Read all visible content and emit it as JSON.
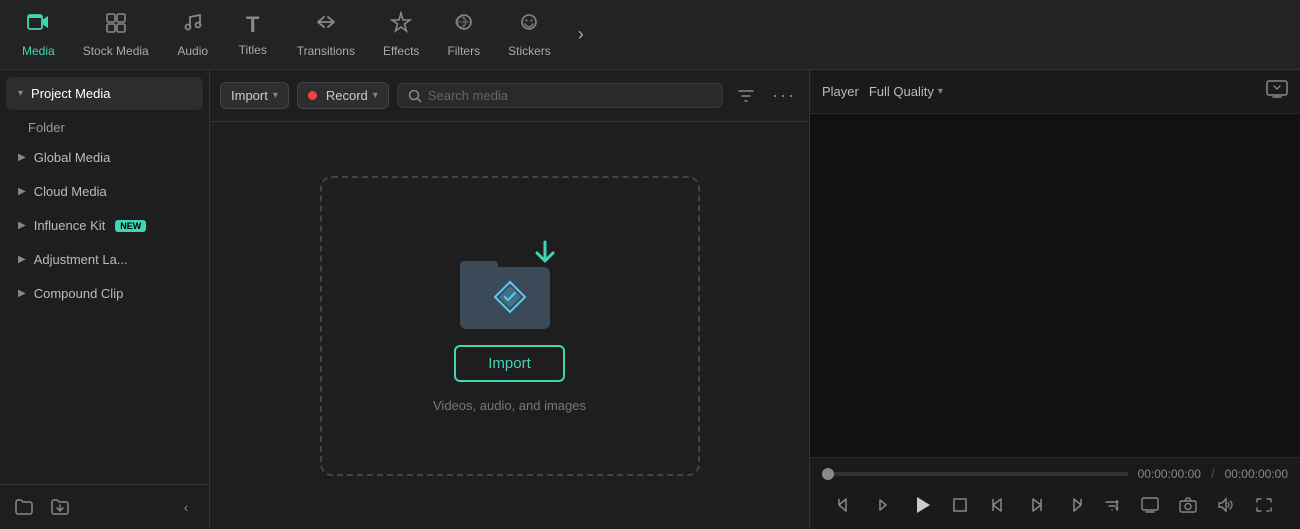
{
  "nav": {
    "items": [
      {
        "id": "media",
        "label": "Media",
        "icon": "🎬",
        "active": true
      },
      {
        "id": "stock-media",
        "label": "Stock Media",
        "icon": "📁"
      },
      {
        "id": "audio",
        "label": "Audio",
        "icon": "🎵"
      },
      {
        "id": "titles",
        "label": "Titles",
        "icon": "T"
      },
      {
        "id": "transitions",
        "label": "Transitions",
        "icon": "↔"
      },
      {
        "id": "effects",
        "label": "Effects",
        "icon": "✦"
      },
      {
        "id": "filters",
        "label": "Filters",
        "icon": "⊛"
      },
      {
        "id": "stickers",
        "label": "Stickers",
        "icon": "◕"
      }
    ],
    "more_icon": "›"
  },
  "sidebar": {
    "items": [
      {
        "id": "project-media",
        "label": "Project Media",
        "active": true,
        "chevron": "▾"
      },
      {
        "id": "folder",
        "label": "Folder",
        "indent": true
      },
      {
        "id": "global-media",
        "label": "Global Media",
        "chevron": "▶"
      },
      {
        "id": "cloud-media",
        "label": "Cloud Media",
        "chevron": "▶"
      },
      {
        "id": "influence-kit",
        "label": "Influence Kit",
        "chevron": "▶",
        "badge": "NEW"
      },
      {
        "id": "adjustment-layer",
        "label": "Adjustment La...",
        "chevron": "▶"
      },
      {
        "id": "compound-clip",
        "label": "Compound Clip",
        "chevron": "▶"
      }
    ],
    "bottom": {
      "new_folder_icon": "□+",
      "import_icon": "⊕",
      "collapse_icon": "‹"
    }
  },
  "toolbar": {
    "import_label": "Import",
    "import_arrow": "▾",
    "record_dot": true,
    "record_label": "Record",
    "record_arrow": "▾",
    "search_placeholder": "Search media",
    "filter_icon": "filter",
    "more_icon": "···"
  },
  "import_zone": {
    "button_label": "Import",
    "subtitle": "Videos, audio, and images"
  },
  "player": {
    "label": "Player",
    "quality": "Full Quality",
    "quality_arrow": "▾",
    "time_current": "00:00:00:00",
    "time_divider": "/",
    "time_total": "00:00:00:00",
    "controls": {
      "step_back": "⏮",
      "frame_back": "◁",
      "play": "▶",
      "stop": "◻",
      "mark_in": "{",
      "mark_out": "}",
      "forward": "⏭",
      "dropdown": "⌵",
      "screen": "⧉",
      "camera": "📷",
      "volume": "🔊",
      "fullscreen": "⤢"
    }
  }
}
